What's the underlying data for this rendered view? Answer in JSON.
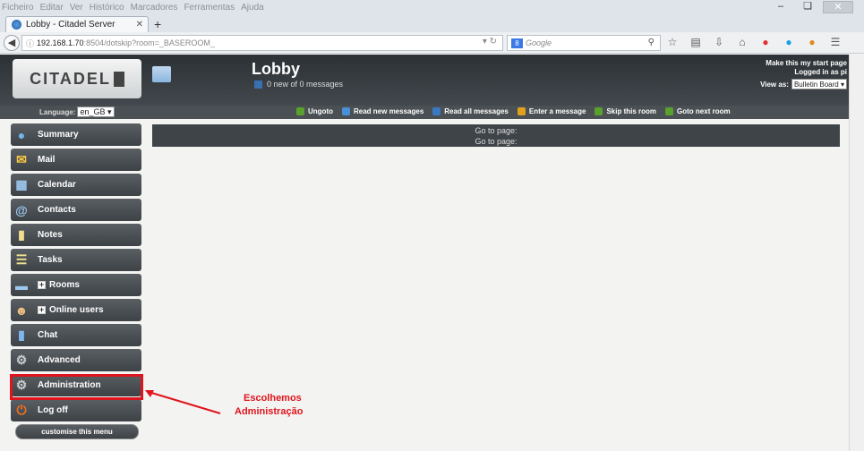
{
  "browser": {
    "menu": [
      "Ficheiro",
      "Editar",
      "Ver",
      "Histórico",
      "Marcadores",
      "Ferramentas",
      "Ajuda"
    ],
    "tab_title": "Lobby - Citadel Server",
    "url_host": "192.168.1.70",
    "url_path": ":8504/dotskip?room=_BASEROOM_",
    "search_placeholder": "Google",
    "new_tab": "+"
  },
  "header": {
    "logo_text": "CITADEL",
    "room_title": "Lobby",
    "room_subtitle": "0 new of 0 messages",
    "start_page": "Make this my start page",
    "logged_in": "Logged in as pi",
    "view_as_label": "View as:",
    "view_as_value": "Bulletin Board"
  },
  "toolbar": {
    "language_label": "Language:",
    "language_value": "en_GB",
    "actions": [
      {
        "label": "Ungoto",
        "icon": "ungoto-icon",
        "color": "#5aa02c"
      },
      {
        "label": "Read new messages",
        "icon": "refresh-icon",
        "color": "#4a90d9"
      },
      {
        "label": "Read all messages",
        "icon": "messages-icon",
        "color": "#3a78c2"
      },
      {
        "label": "Enter a message",
        "icon": "pencil-icon",
        "color": "#e0a020"
      },
      {
        "label": "Skip this room",
        "icon": "skip-icon",
        "color": "#5aa02c"
      },
      {
        "label": "Goto next room",
        "icon": "goto-icon",
        "color": "#5aa02c"
      }
    ]
  },
  "sidebar": {
    "items": [
      {
        "label": "Summary",
        "icon": "globe-icon"
      },
      {
        "label": "Mail",
        "icon": "mail-icon"
      },
      {
        "label": "Calendar",
        "icon": "calendar-icon"
      },
      {
        "label": "Contacts",
        "icon": "contacts-icon"
      },
      {
        "label": "Notes",
        "icon": "notes-icon"
      },
      {
        "label": "Tasks",
        "icon": "tasks-icon"
      },
      {
        "label": "Rooms",
        "icon": "folder-icon",
        "expandable": true
      },
      {
        "label": "Online users",
        "icon": "user-icon",
        "expandable": true
      },
      {
        "label": "Chat",
        "icon": "chat-icon"
      },
      {
        "label": "Advanced",
        "icon": "gear-icon"
      },
      {
        "label": "Administration",
        "icon": "gear-icon"
      },
      {
        "label": "Log off",
        "icon": "power-icon"
      }
    ],
    "customise": "customise this menu"
  },
  "main": {
    "goto_line1": "Go to page:",
    "goto_line2": "Go to page:"
  },
  "annotation": {
    "line1": "Escolhemos",
    "line2": "Administração",
    "color": "#e0141c"
  }
}
